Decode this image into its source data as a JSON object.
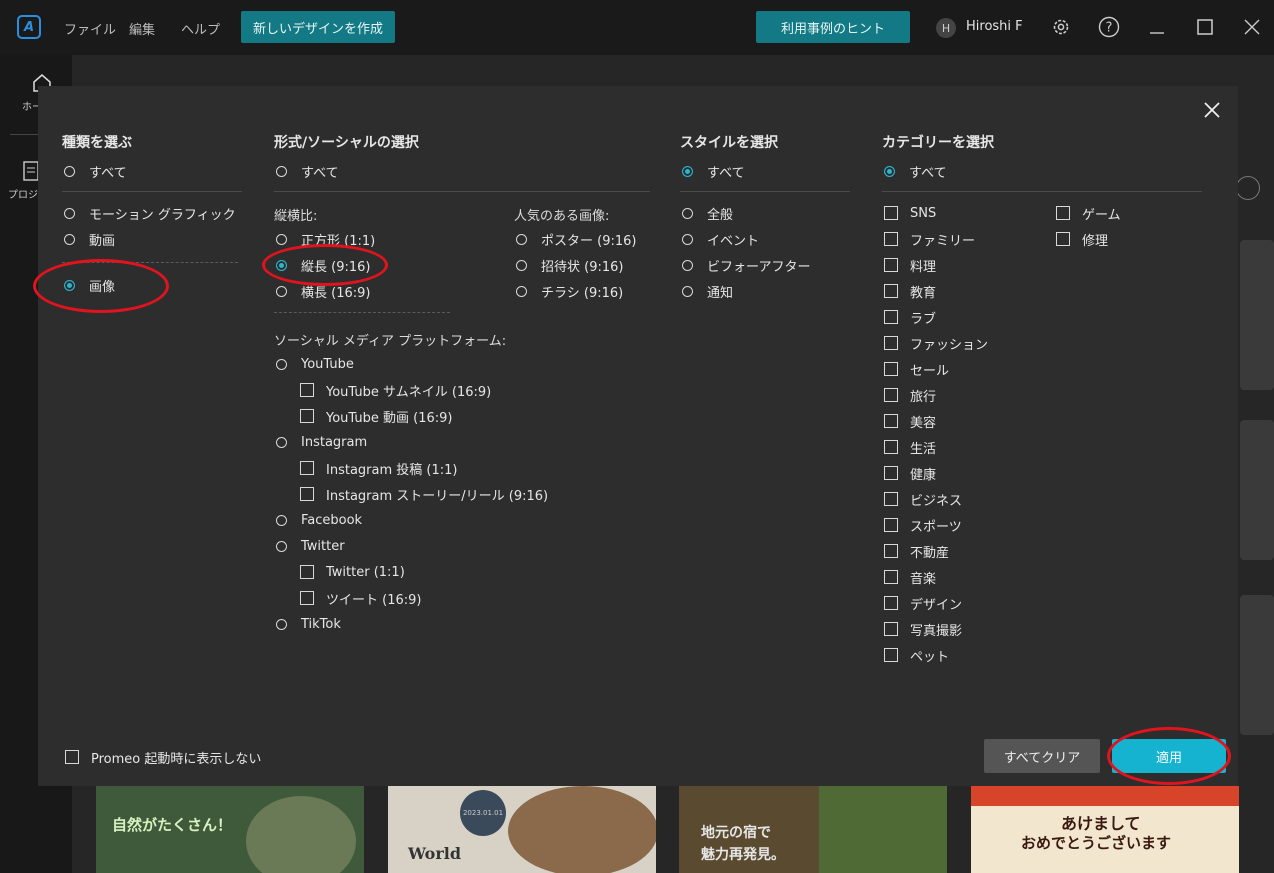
{
  "titlebar": {
    "menus": [
      "ファイル",
      "編集",
      "ヘルプ"
    ],
    "new_design_label": "新しいデザインを作成",
    "hints_label": "利用事例のヒント",
    "avatar_initial": "H",
    "user_name": "Hiroshi F"
  },
  "leftnav": {
    "home_label": "ホー",
    "project_label": "プロジ"
  },
  "background_cards": [
    "自然がたくさん！",
    "World",
    "地元の宿で",
    "魅力再発見。",
    "あけまして",
    "おめでとうございます",
    "2023.01.01"
  ],
  "modal": {
    "type_section": {
      "title": "種類を選ぶ",
      "all": "すべて",
      "options": [
        "モーション グラフィック",
        "動画",
        "画像"
      ],
      "selected": "画像"
    },
    "format_section": {
      "title": "形式/ソーシャルの選択",
      "all": "すべて",
      "aspect_title": "縦横比:",
      "aspect_options": [
        "正方形 (1:1)",
        "縦長 (9:16)",
        "横長 (16:9)"
      ],
      "selected": "縦長 (9:16)",
      "popular_title": "人気のある画像:",
      "popular_options": [
        "ポスター (9:16)",
        "招待状 (9:16)",
        "チラシ (9:16)"
      ],
      "social_title": "ソーシャル メディア プラットフォーム:",
      "youtube": "YouTube",
      "youtube_thumb": "YouTube サムネイル (16:9)",
      "youtube_video": "YouTube 動画 (16:9)",
      "instagram": "Instagram",
      "instagram_post": "Instagram 投稿 (1:1)",
      "instagram_story": "Instagram ストーリー/リール (9:16)",
      "facebook": "Facebook",
      "twitter": "Twitter",
      "twitter_square": "Twitter (1:1)",
      "tweet": "ツイート (16:9)",
      "tiktok": "TikTok"
    },
    "style_section": {
      "title": "スタイルを選択",
      "all": "すべて",
      "options": [
        "全般",
        "イベント",
        "ビフォーアフター",
        "通知"
      ],
      "selected": "すべて"
    },
    "category_section": {
      "title": "カテゴリーを選択",
      "all": "すべて",
      "left": [
        "SNS",
        "ファミリー",
        "料理",
        "教育",
        "ラブ",
        "ファッション",
        "セール",
        "旅行",
        "美容",
        "生活",
        "健康",
        "ビジネス",
        "スポーツ",
        "不動産",
        "音楽",
        "デザイン",
        "写真撮影",
        "ペット"
      ],
      "right": [
        "ゲーム",
        "修理"
      ]
    },
    "dont_show_label": "Promeo 起動時に表示しない",
    "clear_label": "すべてクリア",
    "apply_label": "適用"
  },
  "colors": {
    "accent": "#16b3d0",
    "highlight": "#e0141e",
    "teal_button": "#137a85"
  }
}
